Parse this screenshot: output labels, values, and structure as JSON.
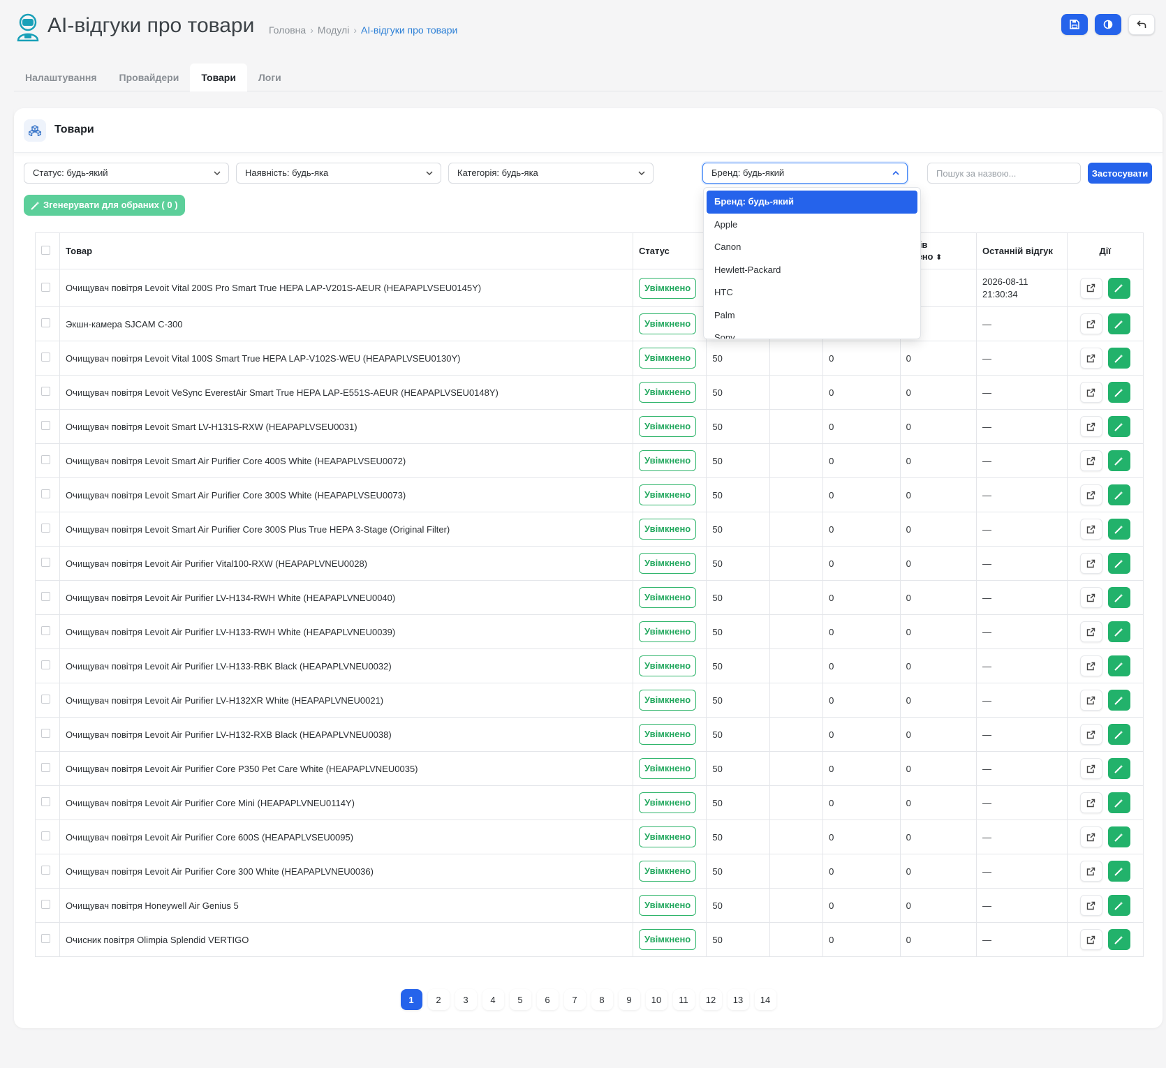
{
  "header": {
    "title": "AI-відгуки про товари",
    "breadcrumb": [
      "Головна",
      "Модулі",
      "AI-відгуки про товари"
    ]
  },
  "tabs": [
    "Налаштування",
    "Провайдери",
    "Товари",
    "Логи"
  ],
  "active_tab": "Товари",
  "card": {
    "title": "Товари"
  },
  "filters": {
    "status": "Статус: будь-який",
    "availability": "Наявність: будь-яка",
    "category": "Категорія: будь-яка",
    "brand": "Бренд: будь-який",
    "search_placeholder": "Пошук за назвою...",
    "apply": "Застосувати"
  },
  "generate_button": "Згенерувати для обраних ( 0 )",
  "brand_dropdown": {
    "options": [
      "Бренд: будь-який",
      "Apple",
      "Canon",
      "Hewlett-Packard",
      "HTC",
      "Palm",
      "Sony"
    ],
    "selected": "Бренд: будь-який"
  },
  "table": {
    "headers": {
      "product": "Товар",
      "status": "Статус",
      "reviews_partial": "гуків",
      "reviews_partial2": "орено",
      "last_review": "Останній відгук",
      "actions": "Дії"
    },
    "rows": [
      {
        "name": "Очищувач повітря Levoit Vital 200S Pro Smart True HEPA LAP-V201S-AEUR (HEAPAPLVSEU0145Y)",
        "status": "Увімкнено",
        "c1": "",
        "c3": "",
        "c4": "",
        "last": "2026-08-11 21:30:34"
      },
      {
        "name": "Экшн-камера SJCAM C-300",
        "status": "Увімкнено",
        "c1": "",
        "c3": "",
        "c4": "",
        "last": "—"
      },
      {
        "name": "Очищувач повітря Levoit Vital 100S Smart True HEPA LAP-V102S-WEU (HEAPAPLVSEU0130Y)",
        "status": "Увімкнено",
        "c1": "50",
        "c3": "0",
        "c4": "0",
        "last": "—"
      },
      {
        "name": "Очищувач повітря Levoit VeSync EverestAir Smart True HEPA LAP-E551S-AEUR (HEAPAPLVSEU0148Y)",
        "status": "Увімкнено",
        "c1": "50",
        "c3": "0",
        "c4": "0",
        "last": "—"
      },
      {
        "name": "Очищувач повітря Levoit Smart LV-H131S-RXW (HEAPAPLVSEU0031)",
        "status": "Увімкнено",
        "c1": "50",
        "c3": "0",
        "c4": "0",
        "last": "—"
      },
      {
        "name": "Очищувач повітря Levoit Smart Air Purifier Core 400S White (HEAPAPLVSEU0072)",
        "status": "Увімкнено",
        "c1": "50",
        "c3": "0",
        "c4": "0",
        "last": "—"
      },
      {
        "name": "Очищувач повітря Levoit Smart Air Purifier Core 300S White (HEAPAPLVSEU0073)",
        "status": "Увімкнено",
        "c1": "50",
        "c3": "0",
        "c4": "0",
        "last": "—"
      },
      {
        "name": "Очищувач повітря Levoit Smart Air Purifier Core 300S Plus True HEPA 3-Stage (Original Filter)",
        "status": "Увімкнено",
        "c1": "50",
        "c3": "0",
        "c4": "0",
        "last": "—"
      },
      {
        "name": "Очищувач повітря Levoit Air Purifier Vital100-RXW (HEAPAPLVNEU0028)",
        "status": "Увімкнено",
        "c1": "50",
        "c3": "0",
        "c4": "0",
        "last": "—"
      },
      {
        "name": "Очищувач повітря Levoit Air Purifier LV-H134-RWH White (HEAPAPLVNEU0040)",
        "status": "Увімкнено",
        "c1": "50",
        "c3": "0",
        "c4": "0",
        "last": "—"
      },
      {
        "name": "Очищувач повітря Levoit Air Purifier LV-H133-RWH White (HEAPAPLVNEU0039)",
        "status": "Увімкнено",
        "c1": "50",
        "c3": "0",
        "c4": "0",
        "last": "—"
      },
      {
        "name": "Очищувач повітря Levoit Air Purifier LV-H133-RBK Black (HEAPAPLVNEU0032)",
        "status": "Увімкнено",
        "c1": "50",
        "c3": "0",
        "c4": "0",
        "last": "—"
      },
      {
        "name": "Очищувач повітря Levoit Air Purifier LV-H132XR White (HEAPAPLVNEU0021)",
        "status": "Увімкнено",
        "c1": "50",
        "c3": "0",
        "c4": "0",
        "last": "—"
      },
      {
        "name": "Очищувач повітря Levoit Air Purifier LV-H132-RXB Black (HEAPAPLVNEU0038)",
        "status": "Увімкнено",
        "c1": "50",
        "c3": "0",
        "c4": "0",
        "last": "—"
      },
      {
        "name": "Очищувач повітря Levoit Air Purifier Core P350 Pet Care White (HEAPAPLVNEU0035)",
        "status": "Увімкнено",
        "c1": "50",
        "c3": "0",
        "c4": "0",
        "last": "—"
      },
      {
        "name": "Очищувач повітря Levoit Air Purifier Core Mini (HEAPAPLVNEU0114Y)",
        "status": "Увімкнено",
        "c1": "50",
        "c3": "0",
        "c4": "0",
        "last": "—"
      },
      {
        "name": "Очищувач повітря Levoit Air Purifier Core 600S (HEAPAPLVSEU0095)",
        "status": "Увімкнено",
        "c1": "50",
        "c3": "0",
        "c4": "0",
        "last": "—"
      },
      {
        "name": "Очищувач повітря Levoit Air Purifier Core 300 White (HEAPAPLVNEU0036)",
        "status": "Увімкнено",
        "c1": "50",
        "c3": "0",
        "c4": "0",
        "last": "—"
      },
      {
        "name": "Очищувач повітря Honeywell Air Genius 5",
        "status": "Увімкнено",
        "c1": "50",
        "c3": "0",
        "c4": "0",
        "last": "—"
      },
      {
        "name": "Очисник повітря Olimpia Splendid VERTIGO",
        "status": "Увімкнено",
        "c1": "50",
        "c3": "0",
        "c4": "0",
        "last": "—"
      }
    ]
  },
  "pagination": {
    "pages": [
      "1",
      "2",
      "3",
      "4",
      "5",
      "6",
      "7",
      "8",
      "9",
      "10",
      "11",
      "12",
      "13",
      "14"
    ],
    "current": "1"
  },
  "colors": {
    "primary": "#2563eb",
    "success": "#22b26b",
    "success_light": "#5ccf9a"
  },
  "icons": {
    "save": "save-icon",
    "contrast": "contrast-icon",
    "back": "back-arrow-icon",
    "external": "external-link-icon",
    "wand": "magic-wand-icon"
  }
}
